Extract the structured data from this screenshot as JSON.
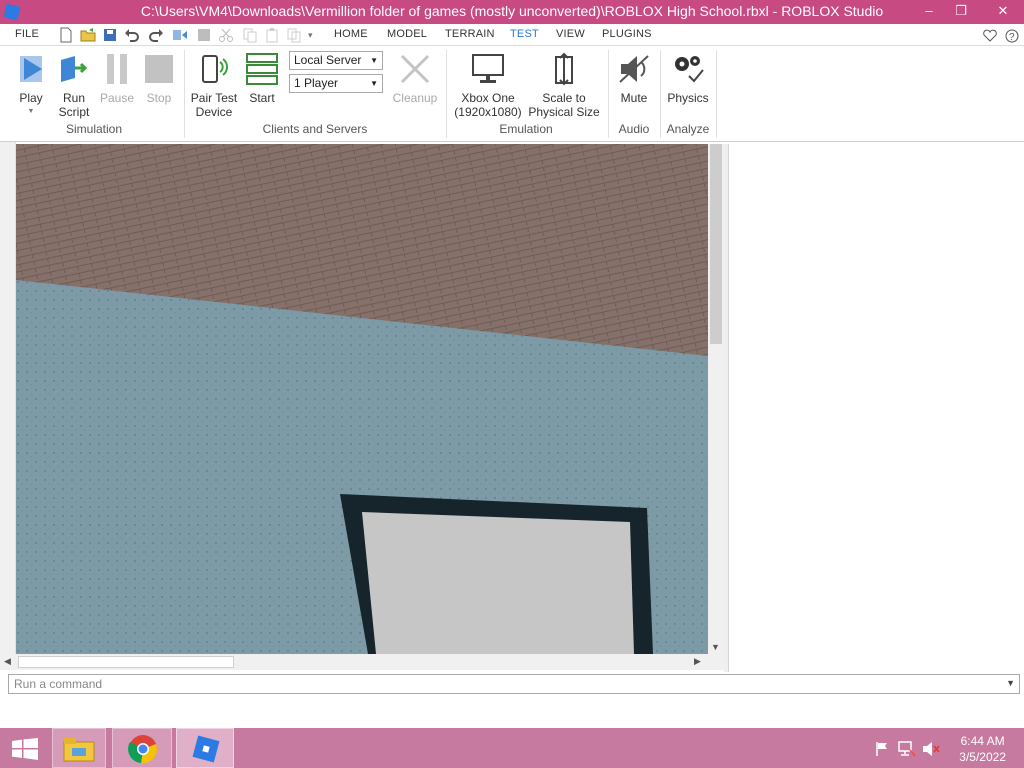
{
  "window": {
    "title": "C:\\Users\\VM4\\Downloads\\Vermillion folder of games (mostly unconverted)\\ROBLOX High School.rbxl - ROBLOX Studio",
    "minimize_icon": "minimize-icon",
    "restore_icon": "restore-icon",
    "close_icon": "close-icon"
  },
  "menu": {
    "file": "FILE",
    "tabs": [
      "HOME",
      "MODEL",
      "TERRAIN",
      "TEST",
      "VIEW",
      "PLUGINS"
    ],
    "active_tab": "TEST"
  },
  "ribbon": {
    "simulation": {
      "play": "Play",
      "run_script": "Run Script",
      "pause": "Pause",
      "stop": "Stop",
      "label": "Simulation"
    },
    "clients_servers": {
      "pair_test_device": "Pair Test Device",
      "start": "Start",
      "server_select": "Local Server",
      "players_select": "1 Player",
      "cleanup": "Cleanup",
      "label": "Clients and Servers"
    },
    "emulation": {
      "device_line1": "Xbox One",
      "device_line2": "(1920x1080)",
      "scale_line1": "Scale to",
      "scale_line2": "Physical Size",
      "label": "Emulation"
    },
    "audio": {
      "mute": "Mute",
      "label": "Audio"
    },
    "analyze": {
      "physics": "Physics",
      "label": "Analyze"
    }
  },
  "command_bar": {
    "placeholder": "Run a command"
  },
  "taskbar": {
    "time": "6:44 AM",
    "date": "3/5/2022",
    "apps": [
      "start-icon",
      "file-explorer-icon",
      "chrome-icon",
      "roblox-studio-icon"
    ]
  },
  "colors": {
    "titlebar": "#c84a82",
    "taskbar": "#c67a9f",
    "active_tab": "#2b79d6",
    "wall": "#7d9ba6",
    "ceiling": "#85706a"
  }
}
